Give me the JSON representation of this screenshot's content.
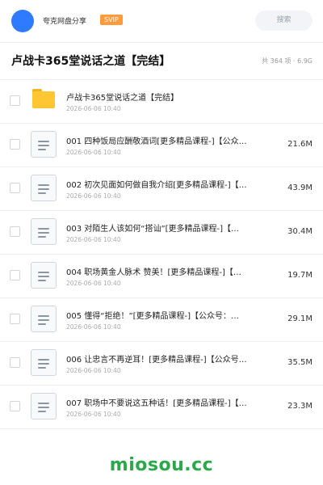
{
  "header": {
    "brand": "夸克网盘分享",
    "badge": "SVIP",
    "search_placeholder": "搜索"
  },
  "folder": {
    "title": "卢战卡365堂说话之道【完结】",
    "summary": "共 364 项 · 6.9G"
  },
  "items": [
    {
      "type": "folder",
      "name": "卢战卡365堂说话之道【完结】",
      "date": "2026-06-06 10:40",
      "size": ""
    },
    {
      "type": "file",
      "name": "001 四种饭局应酬敬酒词[更多精品课程-]【公众…",
      "date": "2026-06-06 10:40",
      "size": "21.6M"
    },
    {
      "type": "file",
      "name": "002 初次见面如何做自我介绍[更多精品课程-]【…",
      "date": "2026-06-06 10:40",
      "size": "43.9M"
    },
    {
      "type": "file",
      "name": "003 对陌生人该如何“搭讪”[更多精品课程-]【…",
      "date": "2026-06-06 10:40",
      "size": "30.4M"
    },
    {
      "type": "file",
      "name": "004 职场黄金人脉术 赞美！[更多精品课程-]【…",
      "date": "2026-06-06 10:40",
      "size": "19.7M"
    },
    {
      "type": "file",
      "name": "005 懂得“拒绝！”[更多精品课程-]【公众号：…",
      "date": "2026-06-06 10:40",
      "size": "29.1M"
    },
    {
      "type": "file",
      "name": "006 让忠言不再逆耳！[更多精品课程-]【公众号…",
      "date": "2026-06-06 10:40",
      "size": "35.5M"
    },
    {
      "type": "file",
      "name": "007 职场中不要说这五种话！[更多精品课程-]【…",
      "date": "2026-06-06 10:40",
      "size": "23.3M"
    }
  ],
  "watermark": "miosou.cc",
  "colors": {
    "avatar": "#2f7bff",
    "badge": "#ff9b3d",
    "folder_icon": "#ffc633",
    "watermark": "#2aa84a"
  }
}
